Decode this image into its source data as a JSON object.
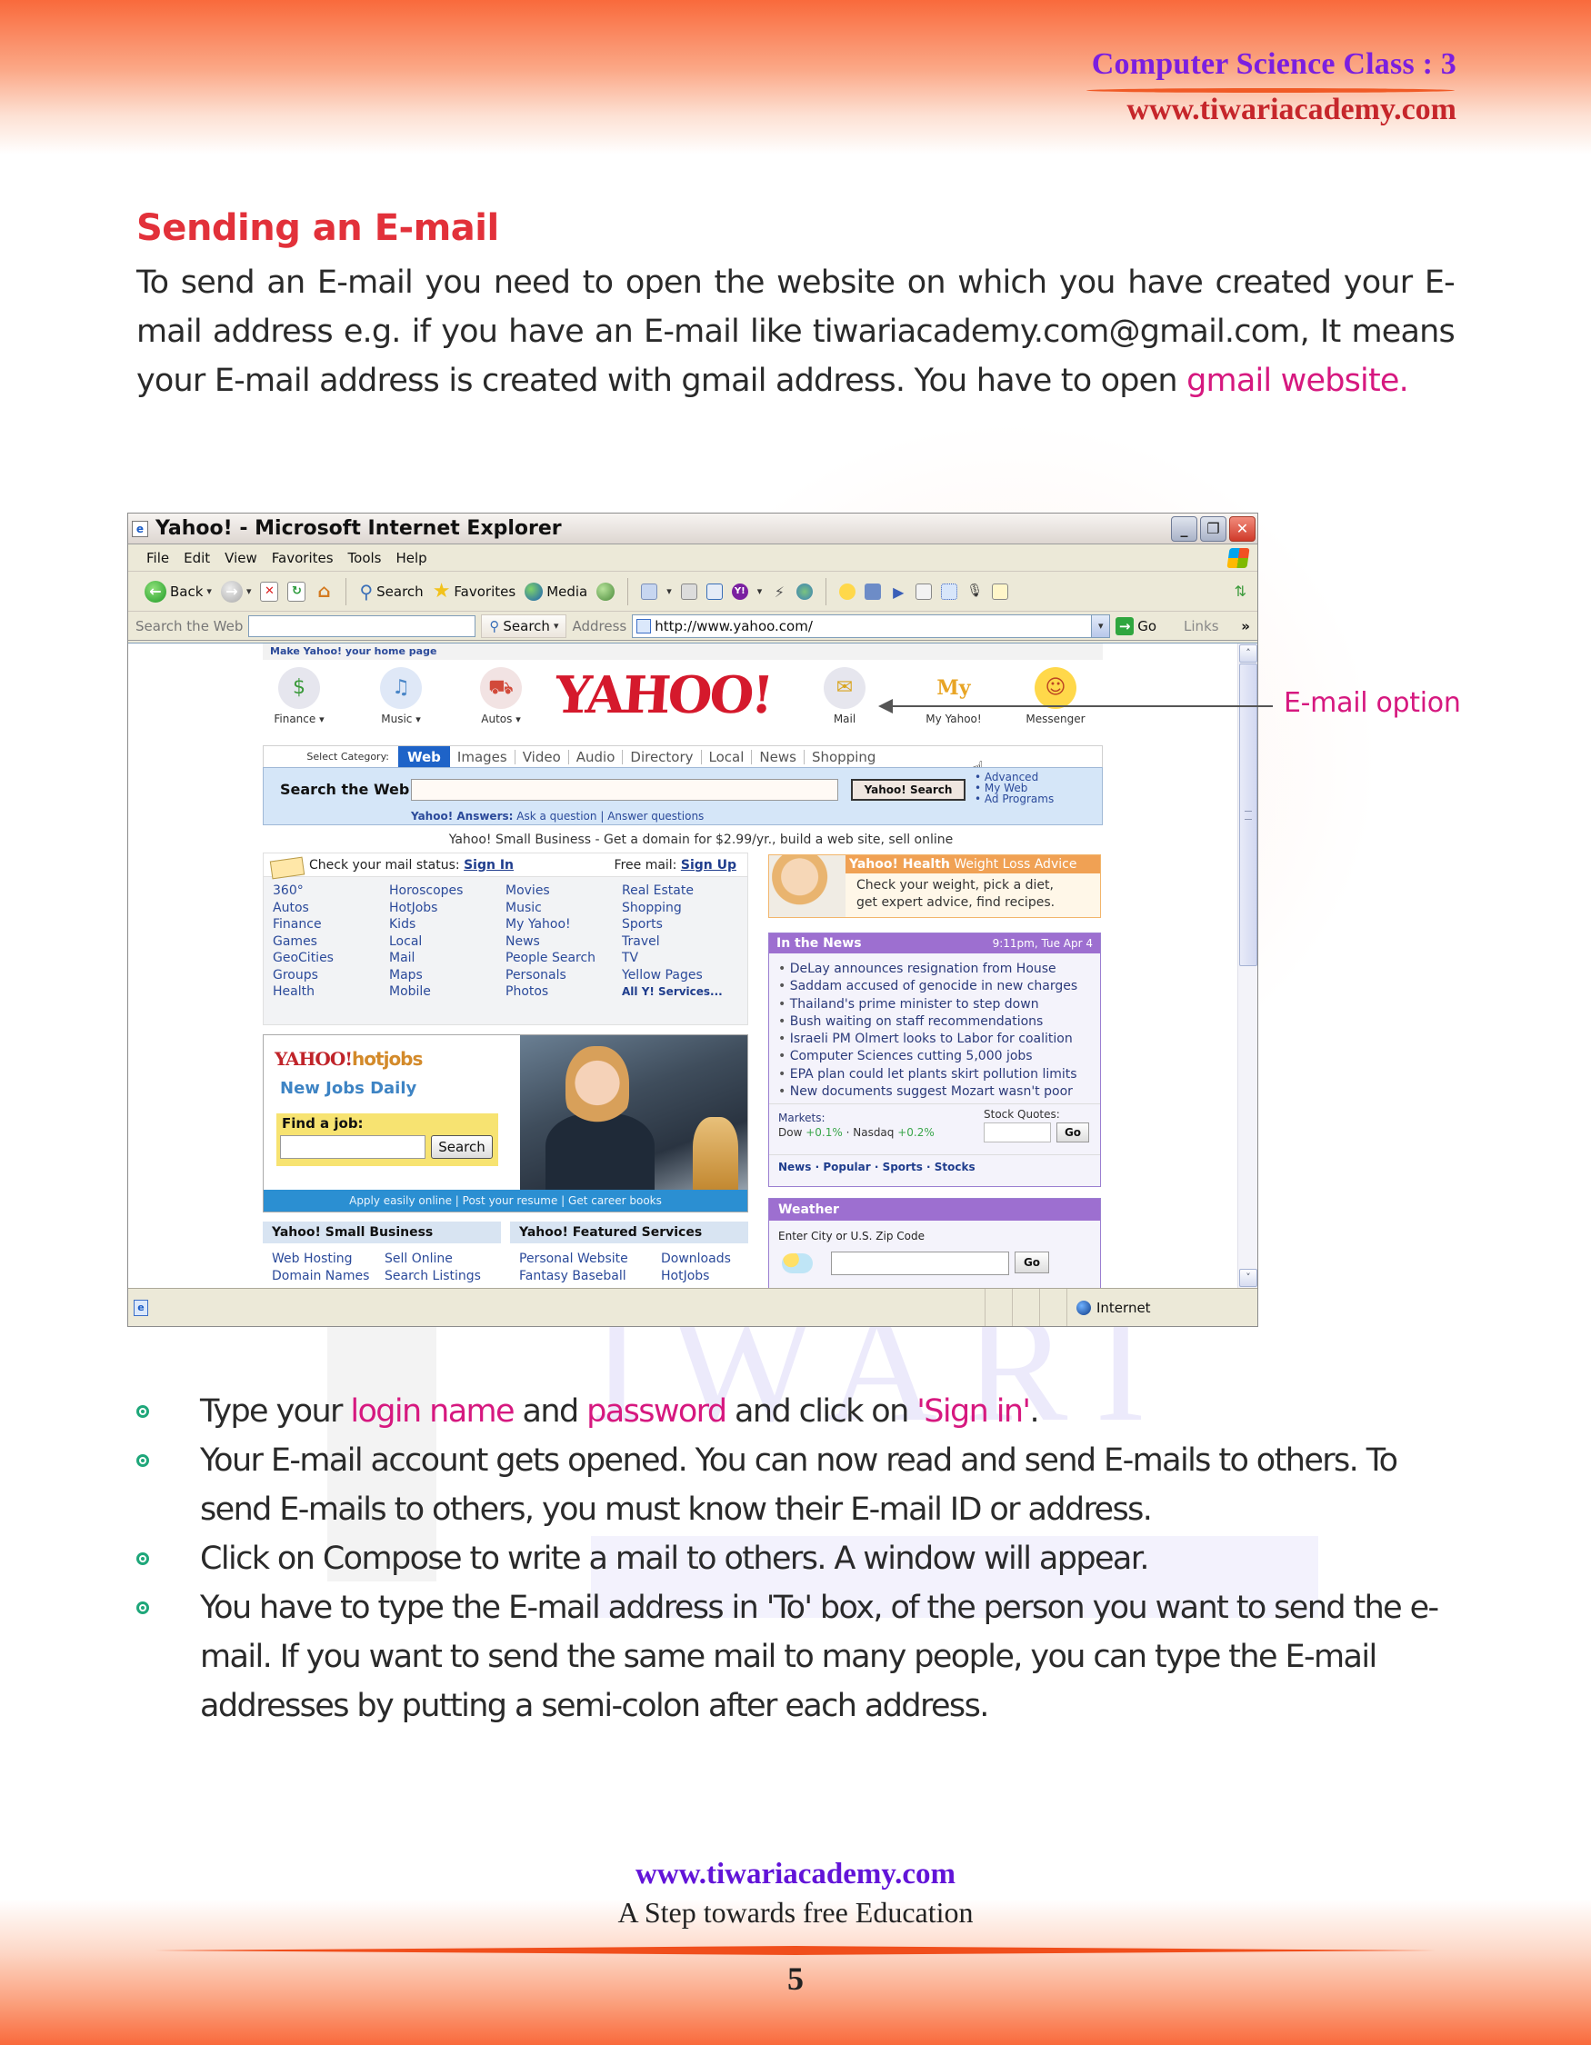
{
  "header": {
    "class_label": "Computer Science Class : 3",
    "site_url": "www.tiwariacademy.com"
  },
  "section": {
    "title": "Sending an E-mail",
    "intro_text": "To send an E-mail you need to open the website on which you have created your E-mail address e.g. if you have an E-mail like tiwariacademy.com@gmail.com, It means your E-mail address is created with gmail address. You have to open ",
    "intro_highlight": "gmail website."
  },
  "browser": {
    "title": "Yahoo! - Microsoft Internet Explorer",
    "menu": [
      "File",
      "Edit",
      "View",
      "Favorites",
      "Tools",
      "Help"
    ],
    "toolbar": {
      "back": "Back",
      "search": "Search",
      "favorites": "Favorites",
      "media": "Media"
    },
    "address_bar": {
      "search_web_label": "Search the Web",
      "search_button": "Search",
      "address_label": "Address",
      "url": "http://www.yahoo.com/",
      "go_label": "Go",
      "links_label": "Links"
    },
    "status": {
      "zone": "Internet"
    },
    "scrollbar": {
      "position_fraction": 0.0,
      "visible_fraction": 0.5
    }
  },
  "yahoo": {
    "make_home": "Make Yahoo! your home page",
    "logo": "YAHOO!",
    "icons": [
      {
        "label": "Finance",
        "icon": "finance-icon",
        "glyph": "💰"
      },
      {
        "label": "Music",
        "icon": "music-icon",
        "glyph": "♫"
      },
      {
        "label": "Autos",
        "icon": "car-icon",
        "glyph": "🚗"
      },
      {
        "label": "Mail",
        "icon": "mail-icon",
        "glyph": "✉"
      },
      {
        "label": "My Yahoo!",
        "icon": "my-yahoo-icon",
        "glyph": "My"
      },
      {
        "label": "Messenger",
        "icon": "messenger-icon",
        "glyph": "☺"
      }
    ],
    "select_category_label": "Select Category:",
    "categories": [
      "Web",
      "Images",
      "Video",
      "Audio",
      "Directory",
      "Local",
      "News",
      "Shopping"
    ],
    "search_label": "Search the Web:",
    "search_button": "Yahoo! Search",
    "search_links": [
      "Advanced",
      "My Web",
      "Ad Programs"
    ],
    "answers_label": "Yahoo! Answers:",
    "answers_links": [
      "Ask a question",
      "Answer questions"
    ],
    "small_business_promo": "Yahoo! Small Business - Get a domain for $2.99/yr., build a web site, sell online",
    "mail_status": {
      "check_label": "Check your mail status:",
      "sign_in": "Sign In",
      "free_label": "Free mail:",
      "sign_up": "Sign Up"
    },
    "services": [
      "360°",
      "Horoscopes",
      "Movies",
      "Real Estate",
      "Autos",
      "HotJobs",
      "Music",
      "Shopping",
      "Finance",
      "Kids",
      "My Yahoo!",
      "Sports",
      "Games",
      "Local",
      "News",
      "Travel",
      "GeoCities",
      "Mail",
      "People Search",
      "TV",
      "Groups",
      "Maps",
      "Personals",
      "Yellow Pages",
      "Health",
      "Mobile",
      "Photos"
    ],
    "all_services": "All Y! Services...",
    "health": {
      "brand": "Yahoo! Health",
      "headline": "Weight Loss Advice",
      "line1": "Check your weight, pick a diet,",
      "line2": "get expert advice, find recipes."
    },
    "news": {
      "title": "In the News",
      "timestamp": "9:11pm, Tue Apr 4",
      "items": [
        "DeLay announces resignation from House",
        "Saddam accused of genocide in new charges",
        "Thailand's prime minister to step down",
        "Bush waiting on staff recommendations",
        "Israeli PM Olmert looks to Labor for coalition",
        "Computer Sciences cutting 5,000 jobs",
        "EPA plan could let plants skirt pollution limits",
        "New documents suggest Mozart wasn't poor"
      ],
      "markets_label": "Markets:",
      "dow_label": "Dow",
      "dow_change": "+0.1%",
      "nasdaq_label": "Nasdaq",
      "nasdaq_change": "+0.2%",
      "stock_quotes_label": "Stock Quotes:",
      "go_button": "Go",
      "footer_links": [
        "News",
        "Popular",
        "Sports",
        "Stocks"
      ]
    },
    "hotjobs": {
      "logo_main": "YAHOO!",
      "logo_sub": "hotjobs",
      "tagline": "New Jobs Daily",
      "find_label": "Find a job:",
      "search_button": "Search",
      "bar_text": "Apply easily online | Post your resume | Get career books"
    },
    "small_business": {
      "title": "Yahoo! Small Business",
      "links": [
        "Web Hosting",
        "Sell Online",
        "Domain Names",
        "Search Listings"
      ]
    },
    "featured": {
      "title": "Yahoo! Featured Services",
      "links": [
        "Personal Website",
        "Downloads",
        "Fantasy Baseball",
        "HotJobs"
      ]
    },
    "weather": {
      "title": "Weather",
      "label": "Enter City or U.S. Zip Code",
      "go_button": "Go"
    }
  },
  "annotation": {
    "label": "E-mail option"
  },
  "bullets": [
    {
      "parts": [
        {
          "text": "Type your ",
          "hl": false
        },
        {
          "text": "login name",
          "hl": true
        },
        {
          "text": " and ",
          "hl": false
        },
        {
          "text": "password",
          "hl": true
        },
        {
          "text": " and click on ",
          "hl": false
        },
        {
          "text": "'Sign in'",
          "hl": true
        },
        {
          "text": ".",
          "hl": false
        }
      ]
    },
    {
      "parts": [
        {
          "text": "Your E-mail account gets opened. You can now read and send E-mails to others. To send E-mails to others, you must know their E-mail ID or address.",
          "hl": false
        }
      ]
    },
    {
      "parts": [
        {
          "text": "Click on Compose to write a mail to others. A window will appear.",
          "hl": false
        }
      ]
    },
    {
      "parts": [
        {
          "text": "You have to type the  E-mail address in 'To' box, of the person you want to send the e-mail. If you want to send the same mail to many  people, you can type the E-mail addresses by putting a semi-colon after each address.",
          "hl": false
        }
      ]
    }
  ],
  "footer": {
    "site_url": "www.tiwariacademy.com",
    "tagline": "A Step towards free Education",
    "page_number": "5"
  },
  "colors": {
    "title_red": "#e2313a",
    "highlight_pink": "#d6187f",
    "header_purple": "#7b1fe0",
    "bullet_green": "#1fa77a",
    "band_orange": "#f96a3c"
  }
}
